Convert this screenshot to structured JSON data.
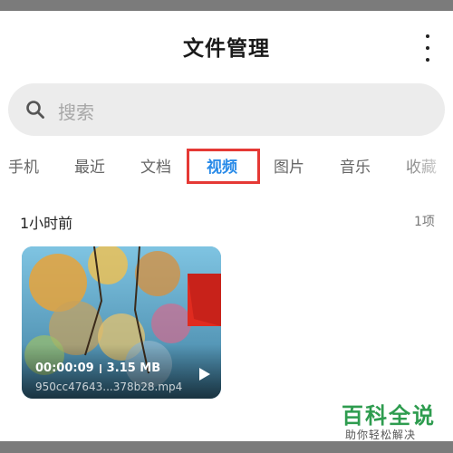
{
  "header": {
    "title": "文件管理",
    "more_icon": "more-vertical-icon"
  },
  "search": {
    "placeholder": "搜索",
    "icon": "search-icon"
  },
  "tabs": [
    {
      "label": "手机",
      "active": false
    },
    {
      "label": "最近",
      "active": false
    },
    {
      "label": "文档",
      "active": false
    },
    {
      "label": "视频",
      "active": true
    },
    {
      "label": "图片",
      "active": false
    },
    {
      "label": "音乐",
      "active": false
    },
    {
      "label": "收藏",
      "active": false
    }
  ],
  "section": {
    "title": "1小时前",
    "count": "1项"
  },
  "video": {
    "duration": "00:00:09",
    "size": "3.15 MB",
    "filename": "950cc47643...378b28.mp4",
    "play_icon": "play-icon"
  },
  "watermark": {
    "main": "百科全说",
    "sub": "助你轻松解决"
  },
  "colors": {
    "accent": "#2a8be8",
    "highlight": "#e53935",
    "watermark": "#2e9c4f"
  }
}
